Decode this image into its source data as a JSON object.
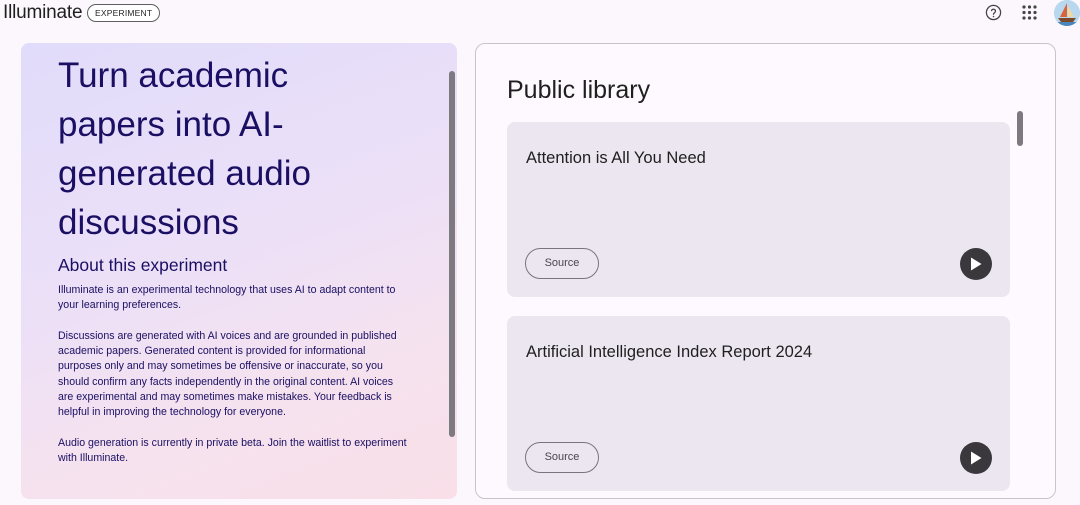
{
  "header": {
    "app_name": "Illuminate",
    "badge": "EXPERIMENT",
    "icons": [
      "help-icon",
      "apps-grid-icon",
      "avatar"
    ]
  },
  "hero": {
    "title": "Turn academic papers into AI-generated audio discussions",
    "about_heading": "About this experiment",
    "paragraphs": [
      "Illuminate is an experimental technology that uses AI to adapt content to your learning preferences.",
      "Discussions are generated with AI voices and are grounded in published academic papers. Generated content is provided for informational purposes only and may sometimes be offensive or inaccurate, so you should confirm any facts independently in the original content. AI voices are experimental and may sometimes make mistakes. Your feedback is helpful in improving the technology for everyone.",
      "Audio generation is currently in private beta. Join the waitlist to experiment with Illuminate."
    ]
  },
  "library": {
    "title": "Public library",
    "papers": [
      {
        "title": "Attention is All You Need",
        "source_label": "Source"
      },
      {
        "title": "Artificial Intelligence Index Report 2024",
        "source_label": "Source"
      }
    ]
  },
  "colors": {
    "hero_text": "#1a0f63",
    "card_bg": "#ece6f0",
    "play_button": "#3b383d"
  }
}
